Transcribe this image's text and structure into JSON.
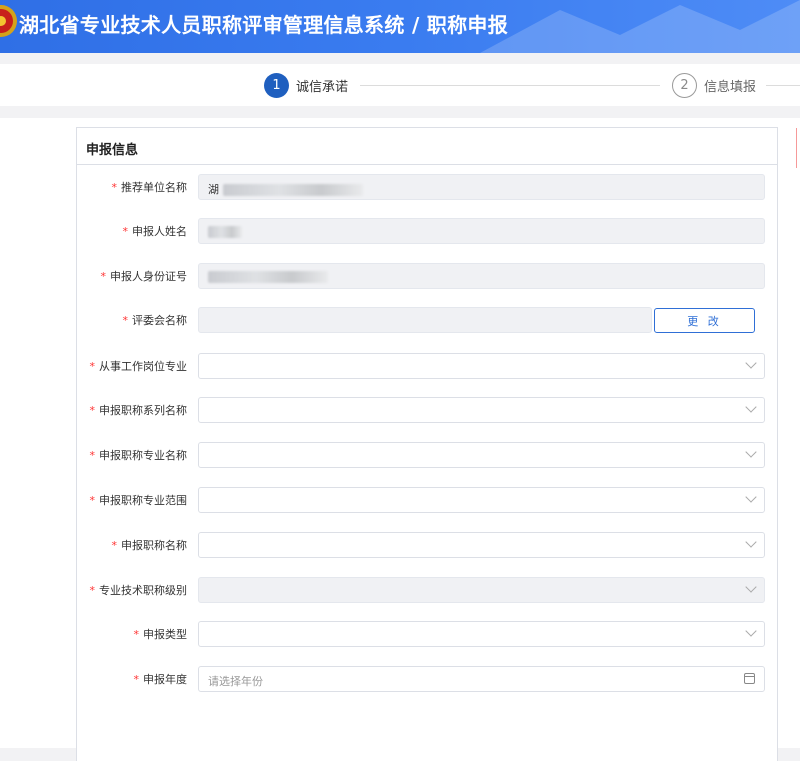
{
  "header": {
    "title": "湖北省专业技术人员职称评审管理信息系统 / 职称申报"
  },
  "steps": [
    {
      "number": "1",
      "label": "诚信承诺",
      "state": "active"
    },
    {
      "number": "2",
      "label": "信息填报",
      "state": "todo"
    }
  ],
  "panel": {
    "title": "申报信息"
  },
  "form": {
    "recommend_unit": {
      "label": "推荐单位名称",
      "value": "湖"
    },
    "applicant_name": {
      "label": "申报人姓名",
      "value": ""
    },
    "applicant_id": {
      "label": "申报人身份证号",
      "value": ""
    },
    "committee": {
      "label": "评委会名称",
      "value": "",
      "button": "更 改"
    },
    "work_post": {
      "label": "从事工作岗位专业"
    },
    "title_series": {
      "label": "申报职称系列名称"
    },
    "title_major": {
      "label": "申报职称专业名称"
    },
    "title_scope": {
      "label": "申报职称专业范围"
    },
    "title_name": {
      "label": "申报职称名称"
    },
    "tech_level": {
      "label": "专业技术职称级别"
    },
    "apply_type": {
      "label": "申报类型"
    },
    "apply_year": {
      "label": "申报年度",
      "placeholder": "请选择年份"
    }
  },
  "colors": {
    "header_blue": "#3a7cf0",
    "step_active": "#1f5fbf",
    "required": "#ff3333",
    "button_blue": "#2f6fd6"
  }
}
